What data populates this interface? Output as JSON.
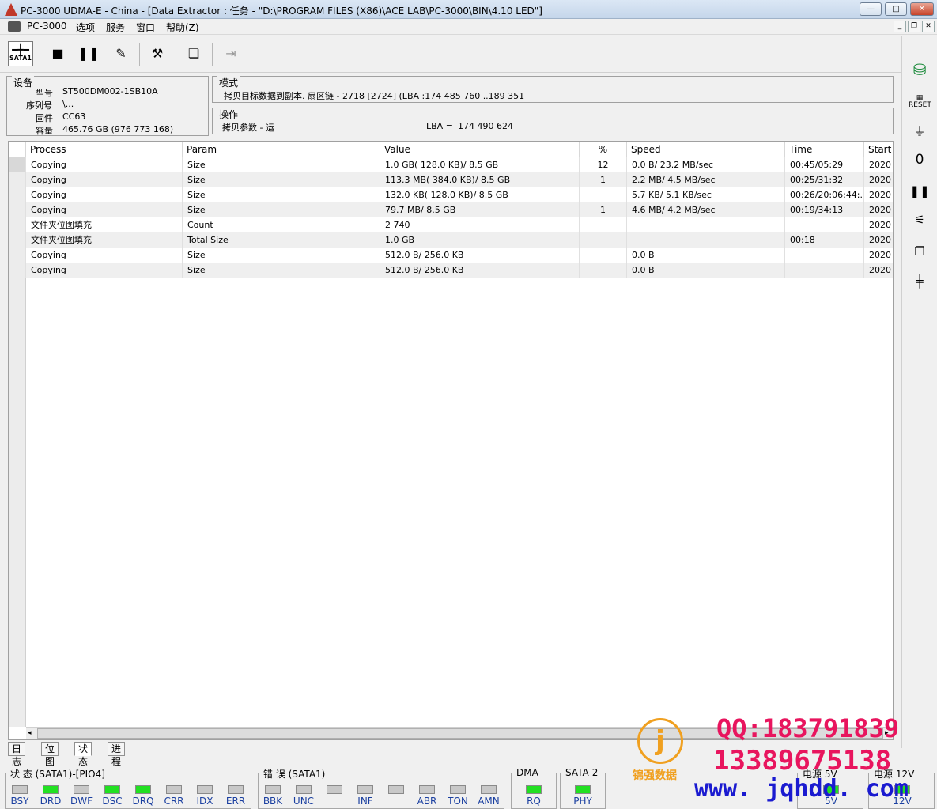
{
  "window": {
    "title": "PC-3000 UDMA-E - China - [Data Extractor : 任务 - \"D:\\PROGRAM FILES (X86)\\ACE LAB\\PC-3000\\BIN\\4.10 LED\"]",
    "min_label": "—",
    "max_label": "□",
    "close_label": "✕"
  },
  "menu": [
    "PC-3000",
    "选项",
    "服务",
    "窗口",
    "帮助(Z)"
  ],
  "toolbar": {
    "sata_label": "SATA1"
  },
  "device": {
    "legend": "设备",
    "model_label": "型号",
    "model": "ST500DM002-1SB10A",
    "serial_label": "序列号",
    "serial": "\\...",
    "firmware_label": "固件",
    "firmware": "CC63",
    "capacity_label": "容量",
    "capacity": "465.76 GB (976 773 168)"
  },
  "mode": {
    "legend": "模式",
    "text": "拷贝目标数据到副本. 扇区链 - 2718 [2724] (LBA :174 485 760 ..189 351"
  },
  "operation": {
    "legend": "操作",
    "params": "拷贝参数 - 运",
    "lba_label": "LBA =",
    "lba": "174 490 624"
  },
  "table": {
    "columns": [
      "Process",
      "Param",
      "Value",
      "%",
      "Speed",
      "Time",
      "Start"
    ],
    "rows": [
      [
        "Copying",
        "Size",
        "1.0 GB( 128.0 KB)/ 8.5 GB",
        "12",
        "0.0 B/ 23.2 MB/sec",
        "00:45/05:29",
        "2020"
      ],
      [
        "Copying",
        "Size",
        "113.3 MB( 384.0 KB)/ 8.5 GB",
        "1",
        "2.2 MB/ 4.5 MB/sec",
        "00:25/31:32",
        "2020"
      ],
      [
        "Copying",
        "Size",
        "132.0 KB( 128.0 KB)/ 8.5 GB",
        "",
        "5.7 KB/ 5.1 KB/sec",
        "00:26/20:06:44:...",
        "2020"
      ],
      [
        "Copying",
        "Size",
        "79.7 MB/ 8.5 GB",
        "1",
        "4.6 MB/ 4.2 MB/sec",
        "00:19/34:13",
        "2020"
      ],
      [
        "文件夹位图填充",
        "Count",
        "2 740",
        "",
        "",
        "",
        "2020"
      ],
      [
        "文件夹位图填充",
        "Total Size",
        "1.0 GB",
        "",
        "",
        "00:18",
        "2020"
      ],
      [
        "Copying",
        "Size",
        "512.0 B/ 256.0 KB",
        "",
        "0.0 B",
        "",
        "2020"
      ],
      [
        "Copying",
        "Size",
        "512.0 B/ 256.0 KB",
        "",
        "0.0 B",
        "",
        "2020"
      ]
    ]
  },
  "tabs": [
    "日志",
    "位图",
    "状态",
    "进程"
  ],
  "status": {
    "state_label": "状 态 (SATA1)-[PIO4]",
    "state_leds": [
      {
        "label": "BSY",
        "on": false
      },
      {
        "label": "DRD",
        "on": true
      },
      {
        "label": "DWF",
        "on": false
      },
      {
        "label": "DSC",
        "on": true
      },
      {
        "label": "DRQ",
        "on": true
      },
      {
        "label": "CRR",
        "on": false
      },
      {
        "label": "IDX",
        "on": false
      },
      {
        "label": "ERR",
        "on": false
      }
    ],
    "error_label": "错 误 (SATA1)",
    "error_leds": [
      {
        "label": "BBK",
        "on": false
      },
      {
        "label": "UNC",
        "on": false
      },
      {
        "label": "",
        "on": false
      },
      {
        "label": "INF",
        "on": false
      },
      {
        "label": "",
        "on": false
      },
      {
        "label": "ABR",
        "on": false
      },
      {
        "label": "TON",
        "on": false
      },
      {
        "label": "AMN",
        "on": false
      }
    ],
    "dma_label": "DMA",
    "dma_led": {
      "label": "RQ",
      "on": true
    },
    "sata2_label": "SATA-2",
    "sata2_led": {
      "label": "PHY",
      "on": true
    },
    "power5_label": "电源 5V",
    "power5_led": {
      "label": "5V",
      "on": true
    },
    "power12_label": "电源 12V",
    "power12_led": {
      "label": "12V",
      "on": true
    }
  },
  "watermark": {
    "qq": "QQ:183791839",
    "phone": "13389675138",
    "url": "www. jqhdd. com",
    "brand": "锦强数据"
  },
  "colors": {
    "led_on": "#22e022",
    "led_off": "#c8c8c8",
    "watermark_red": "#e8155e",
    "watermark_blue": "#1a1ad0"
  }
}
